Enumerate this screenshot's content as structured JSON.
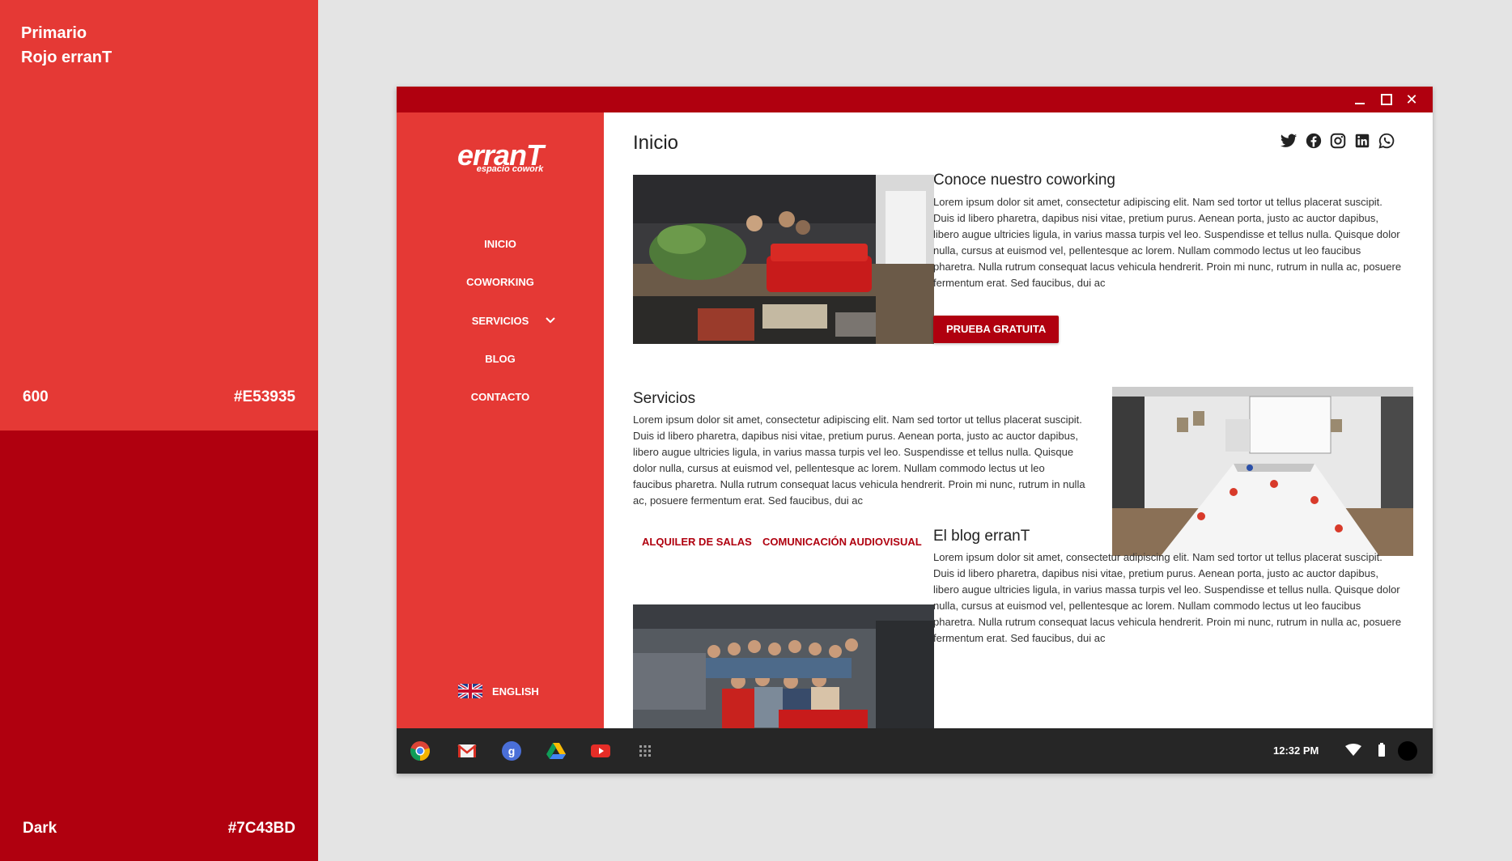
{
  "palette": {
    "primary": {
      "title_line1": "Primario",
      "title_line2": "Rojo erranT",
      "shade": "600",
      "hex": "#E53935"
    },
    "dark": {
      "shade": "Dark",
      "hex": "#7C43BD"
    },
    "colors": {
      "primary": "#E53935",
      "dark": "#B0000F"
    }
  },
  "window": {
    "controls": {
      "minimize": "minimize",
      "maximize": "maximize",
      "close": "✕"
    },
    "sidebar": {
      "logo_main": "erranT",
      "logo_sub": "espacio cowork",
      "nav": [
        "INICIO",
        "COWORKING",
        "SERVICIOS",
        "BLOG",
        "CONTACTO"
      ],
      "language": "ENGLISH"
    },
    "content": {
      "page_title": "Inicio",
      "social_icons": [
        "twitter-icon",
        "facebook-icon",
        "instagram-icon",
        "linkedin-icon",
        "whatsapp-icon"
      ],
      "sections": [
        {
          "title": "Conoce nuestro coworking",
          "text": "Lorem ipsum dolor sit amet, consectetur adipiscing elit. Nam sed tortor ut tellus placerat suscipit. Duis id libero pharetra, dapibus nisi vitae, pretium purus. Aenean porta, justo ac auctor dapibus, libero augue ultricies ligula, in varius massa turpis vel leo. Suspendisse et tellus nulla. Quisque dolor nulla, cursus at euismod vel, pellentesque ac lorem. Nullam commodo lectus ut leo faucibus pharetra. Nulla rutrum consequat lacus vehicula hendrerit. Proin mi nunc, rutrum in nulla ac, posuere fermentum erat. Sed faucibus, dui ac",
          "button": "PRUEBA GRATUITA"
        },
        {
          "title": "Servicios",
          "text": "Lorem ipsum dolor sit amet, consectetur adipiscing elit. Nam sed tortor ut tellus placerat suscipit. Duis id libero pharetra, dapibus nisi vitae, pretium purus. Aenean porta, justo ac auctor dapibus, libero augue ultricies ligula, in varius massa turpis vel leo. Suspendisse et tellus nulla. Quisque dolor nulla, cursus at euismod vel, pellentesque ac lorem. Nullam commodo lectus ut leo faucibus pharetra. Nulla rutrum consequat lacus vehicula hendrerit. Proin mi nunc, rutrum in nulla ac, posuere fermentum erat. Sed faucibus, dui ac",
          "links": [
            "ALQUILER DE SALAS",
            "COMUNICACIÓN AUDIOVISUAL"
          ]
        },
        {
          "title": "El blog erranT",
          "text": "Lorem ipsum dolor sit amet, consectetur adipiscing elit. Nam sed tortor ut tellus placerat suscipit. Duis id libero pharetra, dapibus nisi vitae, pretium purus. Aenean porta, justo ac auctor dapibus, libero augue ultricies ligula, in varius massa turpis vel leo. Suspendisse et tellus nulla. Quisque dolor nulla, cursus at euismod vel, pellentesque ac lorem. Nullam commodo lectus ut leo faucibus pharetra. Nulla rutrum consequat lacus vehicula hendrerit. Proin mi nunc, rutrum in nulla ac, posuere fermentum erat. Sed faucibus, dui ac"
        }
      ]
    },
    "shelf": {
      "apps": [
        "chrome-icon",
        "gmail-icon",
        "google-plus-icon",
        "drive-icon",
        "youtube-icon",
        "app-launcher-icon"
      ],
      "time": "12:32 PM",
      "status_icons": [
        "wifi-icon",
        "battery-icon",
        "avatar"
      ]
    }
  }
}
